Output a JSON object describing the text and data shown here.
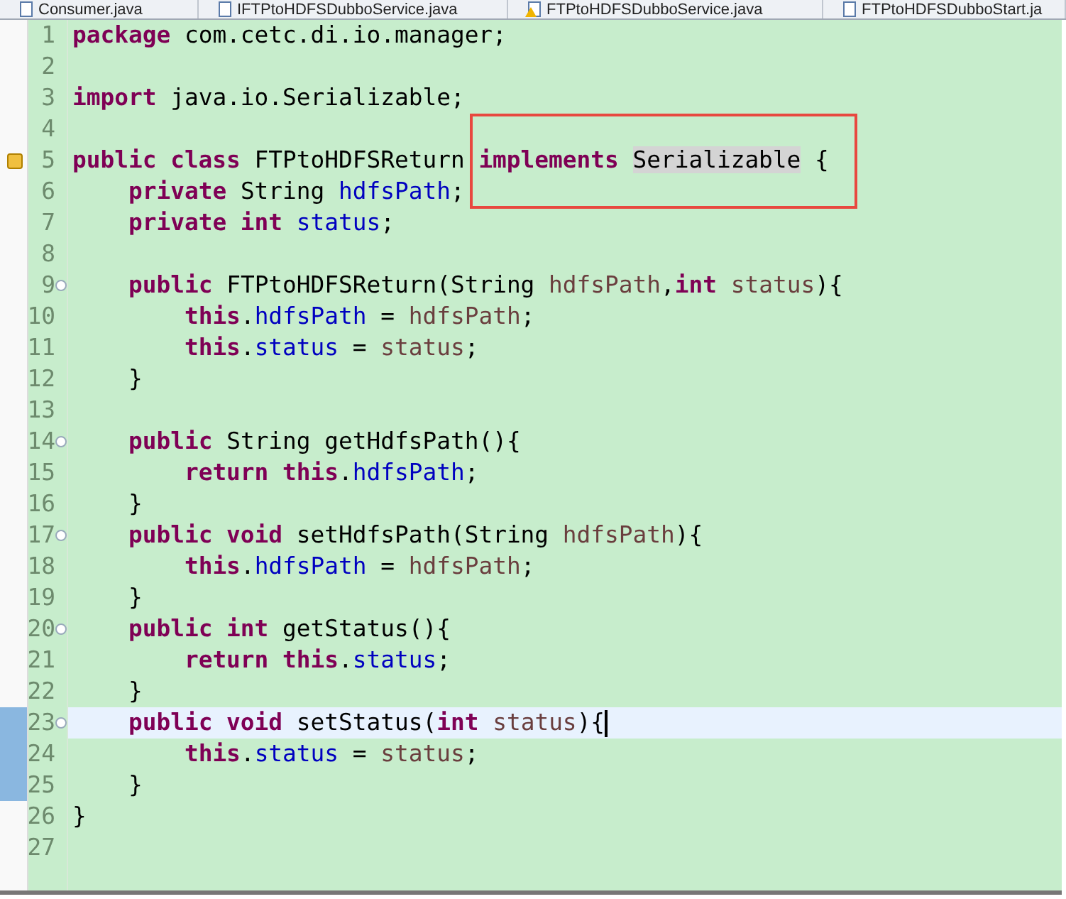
{
  "tabs": [
    {
      "label": "Consumer.java",
      "warning": false
    },
    {
      "label": "IFTPtoHDFSDubboService.java",
      "warning": false
    },
    {
      "label": "FTPtoHDFSDubboService.java",
      "warning": true
    },
    {
      "label": "FTPtoHDFSDubboStart.ja",
      "warning": false
    }
  ],
  "lines": [
    {
      "number": "1",
      "tokens": [
        {
          "kind": "keyword",
          "text": "package"
        },
        {
          "kind": "plain",
          "text": " com.cetc.di.io.manager;"
        }
      ]
    },
    {
      "number": "2"
    },
    {
      "number": "3",
      "tokens": [
        {
          "kind": "keyword",
          "text": "import"
        },
        {
          "kind": "plain",
          "text": " java.io.Serializable;"
        }
      ]
    },
    {
      "number": "4"
    },
    {
      "number": "5",
      "warning": true,
      "tokens": [
        {
          "kind": "keyword",
          "text": "public class"
        },
        {
          "kind": "plain",
          "text": " FTPtoHDFSReturn "
        },
        {
          "kind": "keyword",
          "text": "implements"
        },
        {
          "kind": "occurrence",
          "text": " Serializable"
        },
        {
          "kind": "plain",
          "text": " {"
        }
      ]
    },
    {
      "number": "6",
      "tokens": [
        {
          "kind": "keyword",
          "text": "    private"
        },
        {
          "kind": "plain",
          "text": " String "
        },
        {
          "kind": "field",
          "text": "hdfsPath"
        },
        {
          "kind": "plain",
          "text": ";"
        }
      ]
    },
    {
      "number": "7",
      "tokens": [
        {
          "kind": "keyword",
          "text": "    private int"
        },
        {
          "kind": "field",
          "text": " status"
        },
        {
          "kind": "plain",
          "text": ";"
        }
      ]
    },
    {
      "number": "8"
    },
    {
      "number": "9",
      "fold": true,
      "tokens": [
        {
          "kind": "keyword",
          "text": "    public"
        },
        {
          "kind": "plain",
          "text": " FTPtoHDFSReturn(String "
        },
        {
          "kind": "local",
          "text": "hdfsPath"
        },
        {
          "kind": "plain",
          "text": ","
        },
        {
          "kind": "keyword",
          "text": "int"
        },
        {
          "kind": "local",
          "text": " status"
        },
        {
          "kind": "plain",
          "text": "){"
        }
      ]
    },
    {
      "number": "10",
      "tokens": [
        {
          "kind": "keyword",
          "text": "        this"
        },
        {
          "kind": "plain",
          "text": "."
        },
        {
          "kind": "field",
          "text": "hdfsPath"
        },
        {
          "kind": "plain",
          "text": " = "
        },
        {
          "kind": "local",
          "text": "hdfsPath"
        },
        {
          "kind": "plain",
          "text": ";"
        }
      ]
    },
    {
      "number": "11",
      "tokens": [
        {
          "kind": "keyword",
          "text": "        this"
        },
        {
          "kind": "plain",
          "text": "."
        },
        {
          "kind": "field",
          "text": "status"
        },
        {
          "kind": "plain",
          "text": " = "
        },
        {
          "kind": "local",
          "text": "status"
        },
        {
          "kind": "plain",
          "text": ";"
        }
      ]
    },
    {
      "number": "12",
      "tokens": [
        {
          "kind": "plain",
          "text": "    }"
        }
      ]
    },
    {
      "number": "13"
    },
    {
      "number": "14",
      "fold": true,
      "tokens": [
        {
          "kind": "keyword",
          "text": "    public"
        },
        {
          "kind": "plain",
          "text": " String getHdfsPath(){"
        }
      ]
    },
    {
      "number": "15",
      "tokens": [
        {
          "kind": "keyword",
          "text": "        return this"
        },
        {
          "kind": "plain",
          "text": "."
        },
        {
          "kind": "field",
          "text": "hdfsPath"
        },
        {
          "kind": "plain",
          "text": ";"
        }
      ]
    },
    {
      "number": "16",
      "tokens": [
        {
          "kind": "plain",
          "text": "    }"
        }
      ]
    },
    {
      "number": "17",
      "fold": true,
      "tokens": [
        {
          "kind": "keyword",
          "text": "    public void"
        },
        {
          "kind": "plain",
          "text": " setHdfsPath(String "
        },
        {
          "kind": "local",
          "text": "hdfsPath"
        },
        {
          "kind": "plain",
          "text": "){"
        }
      ]
    },
    {
      "number": "18",
      "tokens": [
        {
          "kind": "keyword",
          "text": "        this"
        },
        {
          "kind": "plain",
          "text": "."
        },
        {
          "kind": "field",
          "text": "hdfsPath"
        },
        {
          "kind": "plain",
          "text": " = "
        },
        {
          "kind": "local",
          "text": "hdfsPath"
        },
        {
          "kind": "plain",
          "text": ";"
        }
      ]
    },
    {
      "number": "19",
      "tokens": [
        {
          "kind": "plain",
          "text": "    }"
        }
      ]
    },
    {
      "number": "20",
      "fold": true,
      "tokens": [
        {
          "kind": "keyword",
          "text": "    public int"
        },
        {
          "kind": "plain",
          "text": " getStatus(){"
        }
      ]
    },
    {
      "number": "21",
      "tokens": [
        {
          "kind": "keyword",
          "text": "        return this"
        },
        {
          "kind": "plain",
          "text": "."
        },
        {
          "kind": "field",
          "text": "status"
        },
        {
          "kind": "plain",
          "text": ";"
        }
      ]
    },
    {
      "number": "22",
      "tokens": [
        {
          "kind": "plain",
          "text": "    }"
        }
      ]
    },
    {
      "number": "23",
      "fold": true,
      "current": true,
      "changed": true,
      "tokens": [
        {
          "kind": "keyword",
          "text": "    public void"
        },
        {
          "kind": "plain",
          "text": " setStatus("
        },
        {
          "kind": "keyword",
          "text": "int"
        },
        {
          "kind": "local",
          "text": " status"
        },
        {
          "kind": "plain",
          "text": "){"
        }
      ]
    },
    {
      "number": "24",
      "changed": true,
      "tokens": [
        {
          "kind": "keyword",
          "text": "        this"
        },
        {
          "kind": "plain",
          "text": "."
        },
        {
          "kind": "field",
          "text": "status"
        },
        {
          "kind": "plain",
          "text": " = "
        },
        {
          "kind": "local",
          "text": "status"
        },
        {
          "kind": "plain",
          "text": ";"
        }
      ]
    },
    {
      "number": "25",
      "changed": true,
      "tokens": [
        {
          "kind": "plain",
          "text": "    }"
        }
      ]
    },
    {
      "number": "26",
      "tokens": [
        {
          "kind": "plain",
          "text": "}"
        }
      ]
    },
    {
      "number": "27"
    }
  ]
}
